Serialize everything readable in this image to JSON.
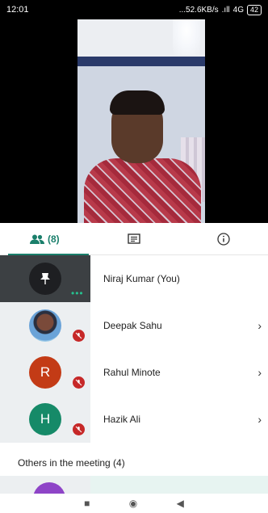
{
  "status_bar": {
    "time": "12:01",
    "net_speed": "...52.6KB/s",
    "signal": "4G",
    "battery": "42"
  },
  "tabs": {
    "people_count": "(8)"
  },
  "participants": [
    {
      "name": "Niraj Kumar (You)",
      "avatar": "pin-icon",
      "muted": false
    },
    {
      "name": "Deepak Sahu",
      "avatar": "photo",
      "muted": true
    },
    {
      "name": "Rahul Minote",
      "avatar_letter": "R",
      "muted": true
    },
    {
      "name": "Hazik Ali",
      "avatar_letter": "H",
      "muted": true
    }
  ],
  "others": {
    "header": "Others in the meeting (4)"
  },
  "colors": {
    "accent": "#1a7f6b",
    "mute": "#c62828",
    "avatar_r": "#c33b16",
    "avatar_h": "#168a68"
  }
}
